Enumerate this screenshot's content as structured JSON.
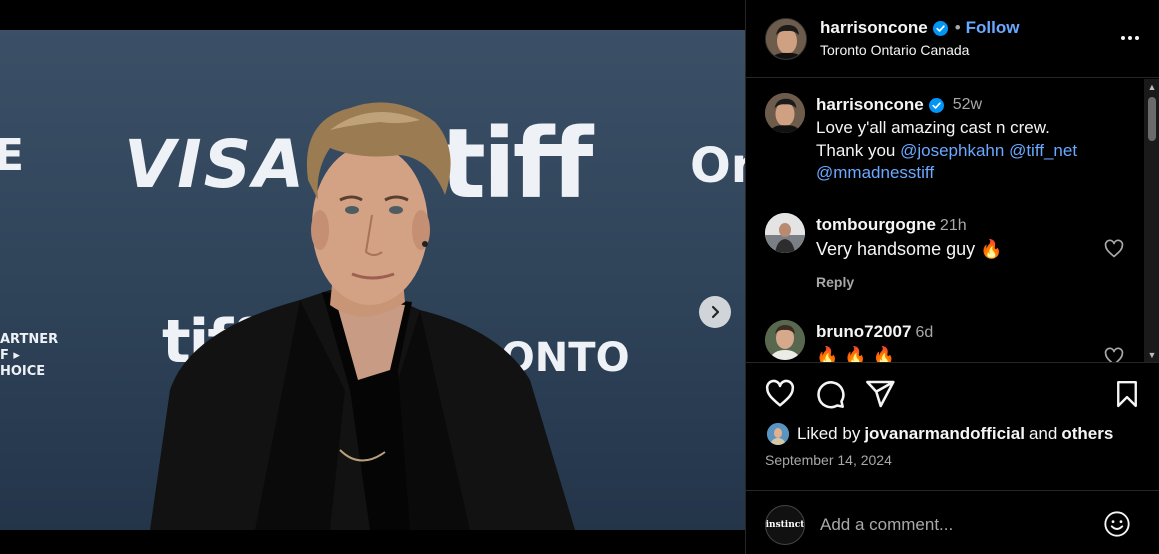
{
  "media": {
    "sign_texts": {
      "visa": "VISA",
      "tiff": "tiff",
      "on": "On",
      "tiff2": "tiff",
      "onto": "RONTO",
      "partner": "ARTNER\nF ▸\nHOICE"
    },
    "carousel": {
      "count": 5,
      "active_index": 0
    }
  },
  "header": {
    "username": "harrisoncone",
    "separator": "•",
    "follow_label": "Follow",
    "location": "Toronto Ontario Canada"
  },
  "caption": {
    "username": "harrisoncone",
    "time": "52w",
    "text_line1": "Love y'all amazing cast n crew.",
    "text_prefix": "Thank you ",
    "mention1": "@josephkahn",
    "mention2": "@tiff_net",
    "mention3": "@mmadnesstiff"
  },
  "comments": [
    {
      "username": "tombourgogne",
      "time": "21h",
      "text": "Very handsome guy 🔥",
      "reply_label": "Reply"
    },
    {
      "username": "bruno72007",
      "time": "6d",
      "text": "🔥🔥🔥"
    }
  ],
  "likes": {
    "prefix": "Liked by",
    "user": "jovanarmandofficial",
    "conjunction": "and",
    "others": "others"
  },
  "date": "September 14, 2024",
  "composer": {
    "avatar_text": "instinct",
    "placeholder": "Add a comment..."
  },
  "colors": {
    "accent": "#6aa9ff",
    "verified": "#0095f6",
    "fire": "#ff6a1a"
  }
}
